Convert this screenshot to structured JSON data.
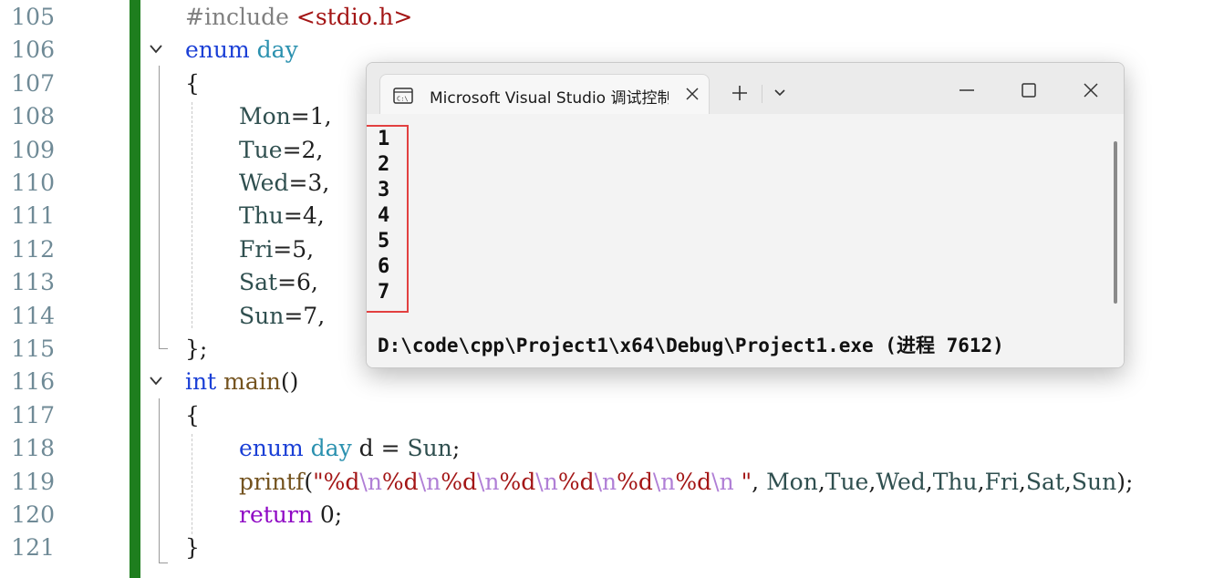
{
  "editor": {
    "lines": [
      {
        "num": "105",
        "parts": [
          {
            "t": "#include ",
            "c": "pp"
          },
          {
            "t": "<stdio.h>",
            "c": "inc"
          }
        ],
        "indent": 203
      },
      {
        "num": "106",
        "fold": true,
        "parts": [
          {
            "t": "enum",
            "c": "kw"
          },
          {
            "t": " "
          },
          {
            "t": "day",
            "c": "ty"
          }
        ],
        "indent": 203
      },
      {
        "num": "107",
        "parts": [
          {
            "t": "{"
          }
        ],
        "indent": 203
      },
      {
        "num": "108",
        "parts": [
          {
            "t": "Mon",
            "c": "en"
          },
          {
            "t": "=1,"
          }
        ],
        "indent": 262
      },
      {
        "num": "109",
        "parts": [
          {
            "t": "Tue",
            "c": "en"
          },
          {
            "t": "=2,"
          }
        ],
        "indent": 262
      },
      {
        "num": "110",
        "parts": [
          {
            "t": "Wed",
            "c": "en"
          },
          {
            "t": "=3,"
          }
        ],
        "indent": 262
      },
      {
        "num": "111",
        "parts": [
          {
            "t": "Thu",
            "c": "en"
          },
          {
            "t": "=4,"
          }
        ],
        "indent": 262
      },
      {
        "num": "112",
        "parts": [
          {
            "t": "Fri",
            "c": "en"
          },
          {
            "t": "=5,"
          }
        ],
        "indent": 262
      },
      {
        "num": "113",
        "parts": [
          {
            "t": "Sat",
            "c": "en"
          },
          {
            "t": "=6,"
          }
        ],
        "indent": 262
      },
      {
        "num": "114",
        "parts": [
          {
            "t": "Sun",
            "c": "en"
          },
          {
            "t": "=7,"
          }
        ],
        "indent": 262
      },
      {
        "num": "115",
        "parts": [
          {
            "t": "};"
          }
        ],
        "indent": 203
      },
      {
        "num": "116",
        "fold": true,
        "parts": [
          {
            "t": "int",
            "c": "kw"
          },
          {
            "t": " "
          },
          {
            "t": "main",
            "c": "fn"
          },
          {
            "t": "()"
          }
        ],
        "indent": 203
      },
      {
        "num": "117",
        "parts": [
          {
            "t": "{"
          }
        ],
        "indent": 203
      },
      {
        "num": "118",
        "parts": [
          {
            "t": "enum",
            "c": "kw"
          },
          {
            "t": " "
          },
          {
            "t": "day",
            "c": "ty"
          },
          {
            "t": " d = "
          },
          {
            "t": "Sun",
            "c": "en"
          },
          {
            "t": ";"
          }
        ],
        "indent": 262
      },
      {
        "num": "119",
        "parts": [
          {
            "t": "printf",
            "c": "fn"
          },
          {
            "t": "("
          },
          {
            "t": "\"%d",
            "c": "str"
          },
          {
            "t": "\\n",
            "c": "esc"
          },
          {
            "t": "%d",
            "c": "str"
          },
          {
            "t": "\\n",
            "c": "esc"
          },
          {
            "t": "%d",
            "c": "str"
          },
          {
            "t": "\\n",
            "c": "esc"
          },
          {
            "t": "%d",
            "c": "str"
          },
          {
            "t": "\\n",
            "c": "esc"
          },
          {
            "t": "%d",
            "c": "str"
          },
          {
            "t": "\\n",
            "c": "esc"
          },
          {
            "t": "%d",
            "c": "str"
          },
          {
            "t": "\\n",
            "c": "esc"
          },
          {
            "t": "%d",
            "c": "str"
          },
          {
            "t": "\\n",
            "c": "esc"
          },
          {
            "t": " \"",
            "c": "str"
          },
          {
            "t": ", "
          },
          {
            "t": "Mon",
            "c": "en"
          },
          {
            "t": ","
          },
          {
            "t": "Tue",
            "c": "en"
          },
          {
            "t": ","
          },
          {
            "t": "Wed",
            "c": "en"
          },
          {
            "t": ","
          },
          {
            "t": "Thu",
            "c": "en"
          },
          {
            "t": ","
          },
          {
            "t": "Fri",
            "c": "en"
          },
          {
            "t": ","
          },
          {
            "t": "Sat",
            "c": "en"
          },
          {
            "t": ","
          },
          {
            "t": "Sun",
            "c": "en"
          },
          {
            "t": ");"
          }
        ],
        "indent": 262
      },
      {
        "num": "120",
        "parts": [
          {
            "t": "return",
            "c": "ctl"
          },
          {
            "t": " 0;"
          }
        ],
        "indent": 262
      },
      {
        "num": "121",
        "parts": [
          {
            "t": "}"
          }
        ],
        "indent": 203
      }
    ]
  },
  "console": {
    "tab_title": "Microsoft Visual Studio 调试控制台",
    "output_lines": [
      "1",
      "2",
      "3",
      "4",
      "5",
      "6",
      "7"
    ],
    "exit_line": "D:\\code\\cpp\\Project1\\x64\\Debug\\Project1.exe (进程 7612)",
    "icons": {
      "tab": "terminal-icon",
      "close_tab": "close-icon",
      "new_tab": "plus-icon",
      "dropdown": "chevron-down-icon",
      "minimize": "minimize-icon",
      "maximize": "maximize-icon",
      "close_window": "close-icon"
    },
    "highlight_color": "#e24040"
  }
}
